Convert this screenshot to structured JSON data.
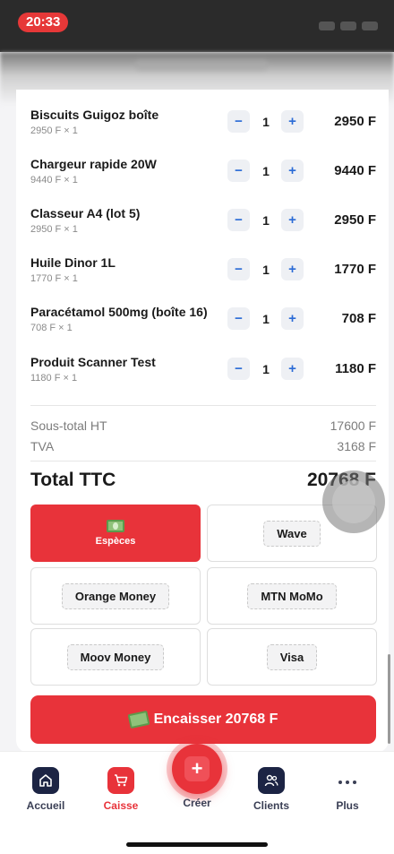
{
  "status_bar": {
    "time": "20:33"
  },
  "cart": {
    "items": [
      {
        "name": "Biscuits Guigoz boîte",
        "unit_line": "2950 F × 1",
        "quantity": "1",
        "total": "2950 F"
      },
      {
        "name": "Chargeur rapide 20W",
        "unit_line": "9440 F × 1",
        "quantity": "1",
        "total": "9440 F"
      },
      {
        "name": "Classeur A4 (lot 5)",
        "unit_line": "2950 F × 1",
        "quantity": "1",
        "total": "2950 F"
      },
      {
        "name": "Huile Dinor 1L",
        "unit_line": "1770 F × 1",
        "quantity": "1",
        "total": "1770 F"
      },
      {
        "name": "Paracétamol 500mg (boîte 16)",
        "unit_line": "708 F × 1",
        "quantity": "1",
        "total": "708 F"
      },
      {
        "name": "Produit Scanner Test",
        "unit_line": "1180 F × 1",
        "quantity": "1",
        "total": "1180 F"
      }
    ],
    "minus_symbol": "−",
    "plus_symbol": "+"
  },
  "summary": {
    "subtotal_label": "Sous-total HT",
    "subtotal_value": "17600 F",
    "tva_label": "TVA",
    "tva_value": "3168 F",
    "total_label": "Total TTC",
    "total_value": "20768 F"
  },
  "payment_methods": {
    "selected": "Espèces",
    "options": [
      "Espèces",
      "Wave",
      "Orange Money",
      "MTN MoMo",
      "Moov Money",
      "Visa"
    ]
  },
  "checkout_button": {
    "label": "Encaisser 20768 F"
  },
  "bottom_nav": {
    "items": [
      {
        "label": "Accueil",
        "icon": "home-icon"
      },
      {
        "label": "Caisse",
        "icon": "cart-icon",
        "active": true
      },
      {
        "label": "Créer",
        "icon": "plus-icon"
      },
      {
        "label": "Clients",
        "icon": "users-icon"
      },
      {
        "label": "Plus",
        "icon": "more-icon"
      }
    ]
  },
  "colors": {
    "accent": "#e8333a",
    "nav_dark": "#1c2444",
    "qty_blue": "#2b6bd6"
  }
}
